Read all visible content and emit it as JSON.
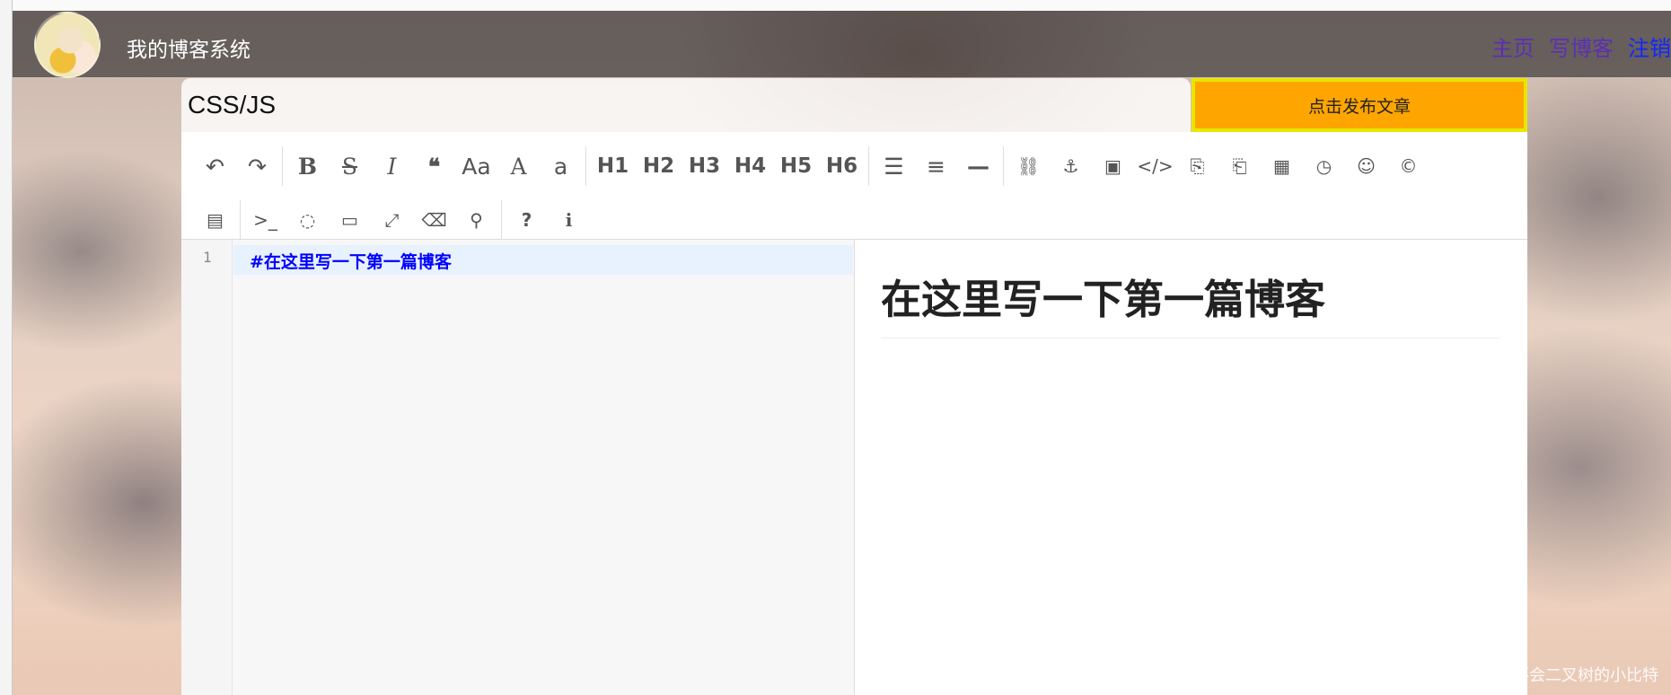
{
  "header": {
    "site_title": "我的博客系统",
    "nav": {
      "home": "主页",
      "write": "写博客",
      "logout": "注销"
    },
    "colors": {
      "bar": "#282628",
      "link": "#5b2fb6",
      "active_link": "#1226ff"
    }
  },
  "article": {
    "title_value": "CSS/JS",
    "publish_label": "点击发布文章",
    "publish_color": "#ffa500"
  },
  "toolbar": {
    "row1": [
      {
        "icon": "undo-icon",
        "glyph": "↶"
      },
      {
        "icon": "redo-icon",
        "glyph": "↷"
      },
      {
        "icon": "bold-icon",
        "glyph": "B"
      },
      {
        "icon": "strikethrough-icon",
        "glyph": "S"
      },
      {
        "icon": "italic-icon",
        "glyph": "I"
      },
      {
        "icon": "quote-icon",
        "glyph": "❝"
      },
      {
        "icon": "uppercase-icon",
        "glyph": "Aa"
      },
      {
        "icon": "uppercase-all-icon",
        "glyph": "A"
      },
      {
        "icon": "lowercase-icon",
        "glyph": "a"
      },
      {
        "icon": "h1-icon",
        "glyph": "H1"
      },
      {
        "icon": "h2-icon",
        "glyph": "H2"
      },
      {
        "icon": "h3-icon",
        "glyph": "H3"
      },
      {
        "icon": "h4-icon",
        "glyph": "H4"
      },
      {
        "icon": "h5-icon",
        "glyph": "H5"
      },
      {
        "icon": "h6-icon",
        "glyph": "H6"
      },
      {
        "icon": "unordered-list-icon",
        "glyph": "☰"
      },
      {
        "icon": "ordered-list-icon",
        "glyph": "≡"
      },
      {
        "icon": "horizontal-rule-icon",
        "glyph": "—"
      },
      {
        "icon": "link-icon",
        "glyph": "⛓"
      },
      {
        "icon": "anchor-icon",
        "glyph": "⚓"
      },
      {
        "icon": "image-icon",
        "glyph": "▣"
      },
      {
        "icon": "code-icon",
        "glyph": "</>"
      },
      {
        "icon": "code-block-icon",
        "glyph": "⎘"
      },
      {
        "icon": "preformatted-icon",
        "glyph": "⎗"
      },
      {
        "icon": "table-icon",
        "glyph": "▦"
      },
      {
        "icon": "datetime-icon",
        "glyph": "◷"
      },
      {
        "icon": "emoji-icon",
        "glyph": "☺"
      },
      {
        "icon": "html-entities-icon",
        "glyph": "©"
      }
    ],
    "row2": [
      {
        "icon": "pagebreak-icon",
        "glyph": "▤"
      },
      {
        "icon": "goto-line-icon",
        "glyph": ">_"
      },
      {
        "icon": "toggle-preview-icon",
        "glyph": "◌"
      },
      {
        "icon": "fullscreen-preview-icon",
        "glyph": "▭"
      },
      {
        "icon": "fullscreen-icon",
        "glyph": "⤢"
      },
      {
        "icon": "clear-icon",
        "glyph": "⌫"
      },
      {
        "icon": "search-icon",
        "glyph": "⚲"
      },
      {
        "icon": "help-icon",
        "glyph": "?"
      },
      {
        "icon": "info-icon",
        "glyph": "i"
      }
    ]
  },
  "editor": {
    "line_number": "1",
    "markdown": "#在这里写一下第一篇博客"
  },
  "preview": {
    "heading": "在这里写一下第一篇博客"
  },
  "watermark": "CSDN @学不会二叉树的小比特"
}
